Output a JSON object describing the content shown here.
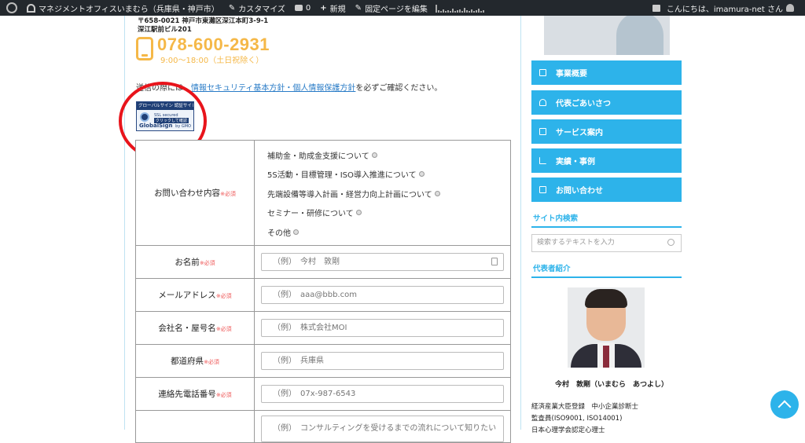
{
  "adminbar": {
    "site_name": "マネジメントオフィスいまむら（兵庫県・神戸市）",
    "customize": "カスタマイズ",
    "comments_count": "0",
    "new": "新規",
    "edit_page": "固定ページを編集",
    "greeting": "こんにちは、imamura-net さん"
  },
  "contact": {
    "address_line1": "〒658-0021 神戸市東灘区深江本町3-9-1",
    "address_line2": "深江駅前ビル201",
    "phone": "078-600-2931",
    "hours": "9:00〜18:00（土日祝除く）",
    "notice_before": "送信の際には、",
    "notice_link": "情報セキュリティ基本方針・個人情報保護方針",
    "notice_after": "を必ずご確認ください。"
  },
  "seal": {
    "top": "グローバルサイン 認証サイト",
    "ssl": "SSL secured",
    "click": "クリックして確認",
    "brand": "GlobalSign",
    "by": "by GMO"
  },
  "form": {
    "required_mark": "※必須",
    "inquiry_label": "お問い合わせ内容",
    "inquiry_options": [
      "補助金・助成金支援について",
      "5S活動・目標管理・ISO導入推進について",
      "先端設備等導入計画・経営力向上計画について",
      "セミナー・研修について",
      "その他"
    ],
    "name_label": "お名前",
    "name_placeholder": "（例）　今村　敦剛",
    "email_label": "メールアドレス",
    "email_placeholder": "（例）　aaa@bbb.com",
    "company_label": "会社名・屋号名",
    "company_placeholder": "（例）　株式会社MOI",
    "pref_label": "都道府県",
    "pref_placeholder": "（例）　兵庫県",
    "tel_label": "連絡先電話番号",
    "tel_placeholder": "（例）　07x-987-6543",
    "message_placeholder": "（例）　コンサルティングを受けるまでの流れについて知りたい"
  },
  "sidebar": {
    "menu": [
      {
        "label": "事業概要",
        "icon": "edit-icon"
      },
      {
        "label": "代表ごあいさつ",
        "icon": "user-icon"
      },
      {
        "label": "サービス案内",
        "icon": "cart-icon"
      },
      {
        "label": "実績・事例",
        "icon": "chart-icon"
      },
      {
        "label": "お問い合わせ",
        "icon": "mail-icon"
      }
    ],
    "search_heading": "サイト内検索",
    "search_placeholder": "検索するテキストを入力",
    "profile_heading": "代表者紹介",
    "rep_name": "今村　敦剛（いまむら　あつよし）",
    "rep_lines": [
      "経済産業大臣登録　中小企業診断士",
      "監査員(ISO9001, ISO14001)",
      "日本心理学会認定心理士"
    ]
  },
  "colors": {
    "accent": "#2db3ea",
    "phone": "#f5b848",
    "highlight_circle": "#e8141b",
    "adminbar": "#23282d"
  }
}
